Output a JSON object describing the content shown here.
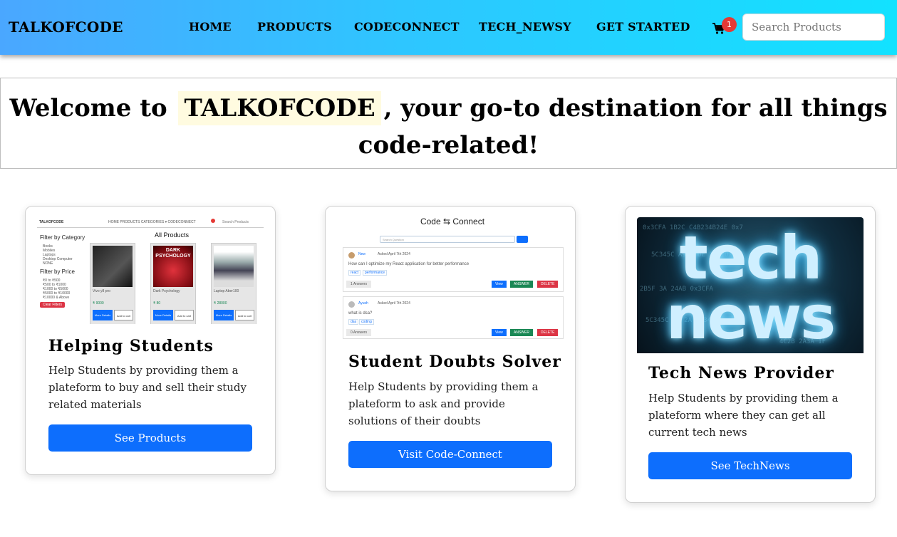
{
  "navbar": {
    "brand": "TALKOFCODE",
    "links": [
      "HOME",
      "PRODUCTS",
      "CODECONNECT",
      "TECH_NEWSY",
      "GET STARTED"
    ],
    "cart_count": "1",
    "search_placeholder": "Search Products"
  },
  "hero": {
    "prefix": "Welcome to",
    "brand": "TALKOFCODE",
    "suffix_line1": ", your go-to destination for all things",
    "suffix_line2": "code-related!"
  },
  "cards": [
    {
      "title": "Helping Students",
      "text": "Help Students by providing them a plateform to buy and sell their study related materials",
      "button": "See Products"
    },
    {
      "title": "Student Doubts Solver",
      "text": "Help Students by providing them a plateform to ask and provide solutions of their doubts",
      "button": "Visit Code-Connect"
    },
    {
      "title": "Tech News Provider",
      "text": "Help Students by providing them a plateform where they can get all current tech news",
      "button": "See TechNews"
    }
  ],
  "thumb_products": {
    "brand": "TALKOFCODE",
    "nav": "HOME  PRODUCTS  CATEGORIES ▾  CODECONNECT",
    "search": "Search Products",
    "filter_category": "Filter by Category",
    "categories": [
      "Books",
      "Mobiles",
      "Laptops",
      "Desktop Computer",
      "NONE"
    ],
    "filter_price": "Filter by Price",
    "prices": [
      "₹0 to ₹500",
      "₹500 to ₹1000",
      "₹1000 to ₹5000",
      "₹5000 to ₹10000",
      "₹10000 & Above"
    ],
    "clear": "Clear Filters",
    "heading": "All Products",
    "products": [
      {
        "name": "Vivo y8 pro",
        "price": "₹ 9000"
      },
      {
        "name": "Dark Psychology",
        "price": "₹ 80"
      },
      {
        "name": "Laptop Aber100",
        "price": "₹ 28000"
      }
    ],
    "more": "More Details",
    "add": "Add to cart",
    "book_title": "DARK PSYCHOLOGY"
  },
  "thumb_connect": {
    "title": "Code ⇆ Connect",
    "search": "Search Question",
    "questions": [
      {
        "user": "New",
        "asked": "Asked April 7th 2024",
        "q": "How can I optimize my React application for better performance",
        "tags": [
          "react",
          "performance"
        ],
        "answers": "1 Answers"
      },
      {
        "user": "Ayush",
        "asked": "Asked April 7th 2024",
        "q": "what is dsa?",
        "tags": [
          "dsa",
          "coding"
        ],
        "answers": "0 Answers"
      }
    ],
    "view": "View",
    "answer": "ANSWER",
    "delete": "DELETE"
  },
  "thumb_news": {
    "word1": "tech",
    "word2": "news"
  },
  "colors": {
    "nav_gradient_start": "#4aa7ff",
    "nav_gradient_end": "#12e2ff",
    "primary_button": "#0d6efd",
    "badge": "#e53935",
    "hero_highlight": "#fffbe0"
  }
}
